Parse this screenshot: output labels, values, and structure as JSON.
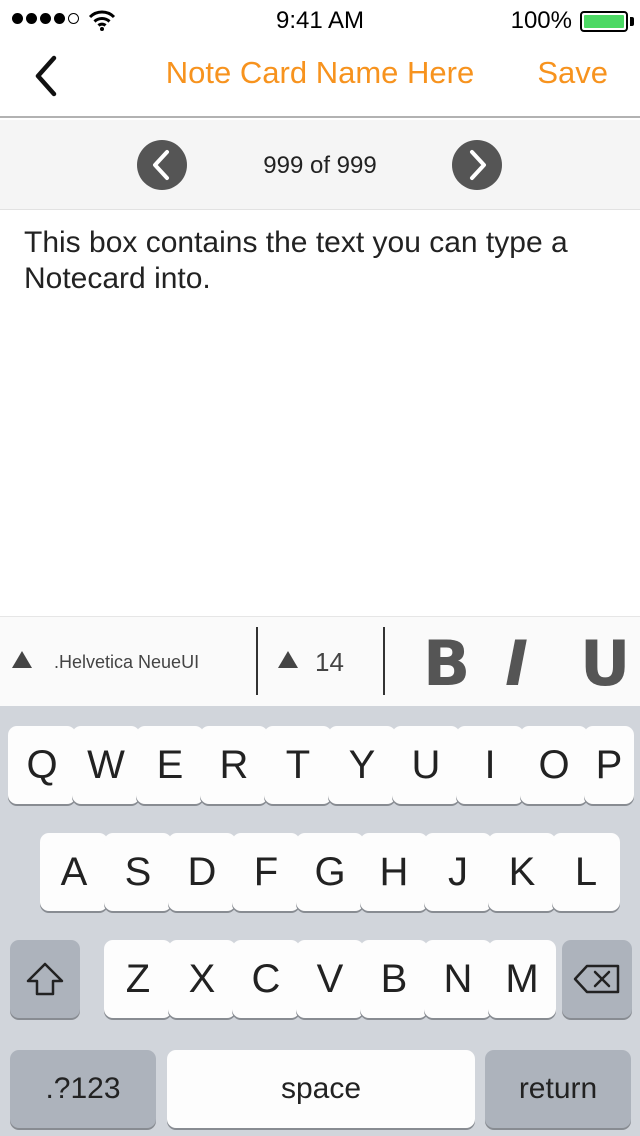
{
  "status": {
    "time": "9:41 AM",
    "battery": "100%",
    "battery_level": 1.0,
    "signal_bars": 4,
    "signal_max": 5
  },
  "nav": {
    "title": "Note Card Name Here",
    "save_label": "Save"
  },
  "pager": {
    "label": "999 of 999"
  },
  "editor": {
    "text": "This box contains the text you can type a Notecard into."
  },
  "format": {
    "font_name": ".Helvetica NeueUI",
    "font_size": "14",
    "bold": "B",
    "italic": "I",
    "underline": "U"
  },
  "keyboard": {
    "row1": [
      "Q",
      "W",
      "E",
      "R",
      "T",
      "Y",
      "U",
      "I",
      "O",
      "P"
    ],
    "row2": [
      "A",
      "S",
      "D",
      "F",
      "G",
      "H",
      "J",
      "K",
      "L"
    ],
    "row3": [
      "Z",
      "X",
      "C",
      "V",
      "B",
      "N",
      "M"
    ],
    "numbers_label": ".?123",
    "space_label": "space",
    "return_label": "return"
  },
  "colors": {
    "accent": "#f7931e",
    "battery_fill": "#4cd964",
    "keyboard_bg": "#d1d5db"
  }
}
